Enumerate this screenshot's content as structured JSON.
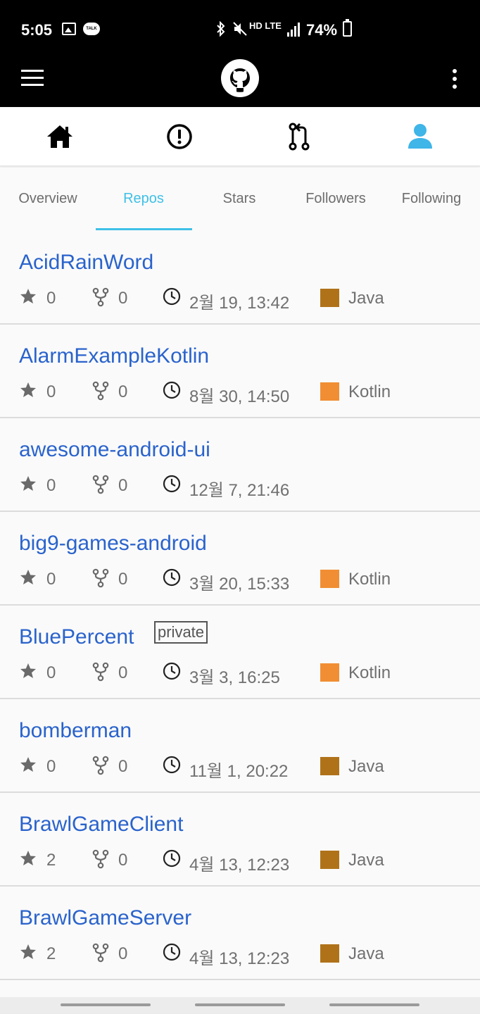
{
  "status_bar": {
    "time": "5:05",
    "network": "HD LTE",
    "battery": "74%"
  },
  "app_bar": {
    "menu_icon": "hamburger-menu-icon",
    "logo_icon": "github-logo-icon",
    "more_icon": "more-vert-icon"
  },
  "nav": {
    "items": [
      {
        "icon": "home-icon",
        "active": false
      },
      {
        "icon": "issues-icon",
        "active": false
      },
      {
        "icon": "pull-request-icon",
        "active": false
      },
      {
        "icon": "profile-icon",
        "active": true
      }
    ],
    "active_color": "#3fb5e8"
  },
  "tabs": [
    {
      "label": "Overview",
      "active": false
    },
    {
      "label": "Repos",
      "active": true
    },
    {
      "label": "Stars",
      "active": false
    },
    {
      "label": "Followers",
      "active": false
    },
    {
      "label": "Following",
      "active": false
    }
  ],
  "repos": [
    {
      "name": "AcidRainWord",
      "private": "",
      "stars": "0",
      "forks": "0",
      "updated": "2월 19, 13:42",
      "language": "Java",
      "lang_color": "#b07219"
    },
    {
      "name": "AlarmExampleKotlin",
      "private": "",
      "stars": "0",
      "forks": "0",
      "updated": "8월 30, 14:50",
      "language": "Kotlin",
      "lang_color": "#f18e33"
    },
    {
      "name": "awesome-android-ui",
      "private": "",
      "stars": "0",
      "forks": "0",
      "updated": "12월 7, 21:46",
      "language": "",
      "lang_color": ""
    },
    {
      "name": "big9-games-android",
      "private": "",
      "stars": "0",
      "forks": "0",
      "updated": "3월 20, 15:33",
      "language": "Kotlin",
      "lang_color": "#f18e33"
    },
    {
      "name": "BluePercent",
      "private": "private",
      "stars": "0",
      "forks": "0",
      "updated": "3월 3, 16:25",
      "language": "Kotlin",
      "lang_color": "#f18e33"
    },
    {
      "name": "bomberman",
      "private": "",
      "stars": "0",
      "forks": "0",
      "updated": "11월 1, 20:22",
      "language": "Java",
      "lang_color": "#b07219"
    },
    {
      "name": "BrawlGameClient",
      "private": "",
      "stars": "2",
      "forks": "0",
      "updated": "4월 13, 12:23",
      "language": "Java",
      "lang_color": "#b07219"
    },
    {
      "name": "BrawlGameServer",
      "private": "",
      "stars": "2",
      "forks": "0",
      "updated": "4월 13, 12:23",
      "language": "Java",
      "lang_color": "#b07219"
    }
  ]
}
